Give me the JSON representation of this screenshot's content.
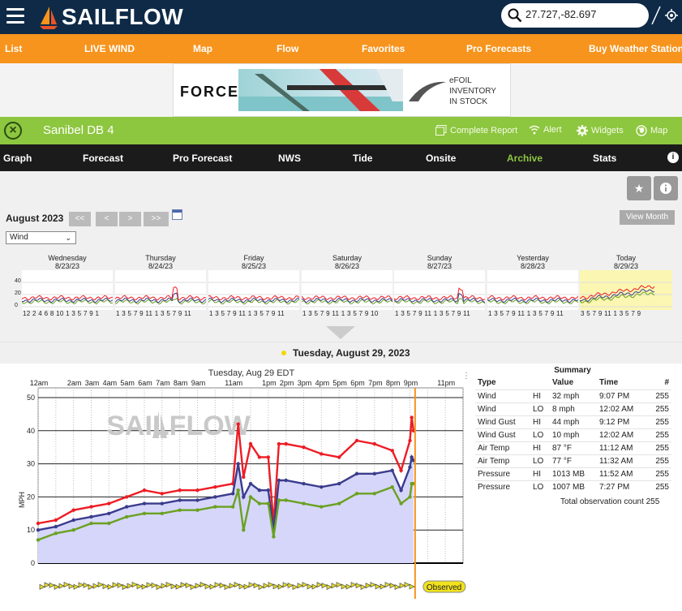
{
  "header": {
    "logo": "SAILFLOW",
    "search_value": "27.727,-82.697"
  },
  "nav": [
    "List",
    "LIVE WIND",
    "Map",
    "Flow",
    "Favorites",
    "Pro Forecasts",
    "Buy Weather Station"
  ],
  "ad": {
    "brand": "FORCE",
    "tag_line1": "eFOIL",
    "tag_line2": "INVENTORY",
    "tag_line3": "IN STOCK"
  },
  "station": {
    "name": "Sanibel DB 4",
    "actions": [
      "Complete Report",
      "Alert",
      "Widgets",
      "Map"
    ]
  },
  "tabs": [
    "Graph",
    "Forecast",
    "Pro Forecast",
    "NWS",
    "Tide",
    "Onsite",
    "Archive",
    "Stats"
  ],
  "active_tab": "Archive",
  "archive": {
    "month": "August 2023",
    "nav_buttons": [
      "<<",
      "<",
      ">",
      ">>"
    ],
    "view_month": "View Month",
    "selected_param": "Wind",
    "days": [
      {
        "name": "Wednesday",
        "date": "8/23/23",
        "axis": "12 2 4 6 8 10 1 3 5 7 9 1"
      },
      {
        "name": "Thursday",
        "date": "8/24/23",
        "axis": "1 3 5 7 9 11 1 3 5 7 9 11"
      },
      {
        "name": "Friday",
        "date": "8/25/23",
        "axis": "1 3 5 7 9 11 1 3 5 7 9 11"
      },
      {
        "name": "Saturday",
        "date": "8/26/23",
        "axis": "1 3 5 7 9 11 1 3 5 7 9 10"
      },
      {
        "name": "Sunday",
        "date": "8/27/23",
        "axis": "1 3 5 7 9 11 1 3 5 7 9 11"
      },
      {
        "name": "Yesterday",
        "date": "8/28/23",
        "axis": "1 3 5 7 9 11 1 3 5 7 9 11"
      },
      {
        "name": "Today",
        "date": "8/29/23",
        "axis": "3 5 7 9 11 1 3 5 7 9"
      }
    ],
    "thumb_yticks": [
      "40",
      "20",
      "0"
    ],
    "selected_date": "Tuesday, August 29, 2023"
  },
  "colors": {
    "brand_navy": "#0f2a47",
    "orange": "#f7941d",
    "station_green": "#8dc63f",
    "active_tab": "#8dc63f",
    "wind": "#3a3c8c",
    "gust": "#ee1c24",
    "lull": "#6aa121",
    "today_highlight": "#fbf6b2",
    "now_line": "#f7941d"
  },
  "chart_data": {
    "type": "line",
    "title": "Tuesday, Aug 29 EDT",
    "xlabel": "",
    "ylabel": "MPH",
    "x_tick_labels": [
      "12am",
      "2am",
      "3am",
      "4am",
      "5am",
      "6am",
      "7am",
      "8am",
      "9am",
      "11am",
      "1pm",
      "2pm",
      "3pm",
      "4pm",
      "5pm",
      "6pm",
      "7pm",
      "8pm",
      "9pm",
      "11pm"
    ],
    "ylim": [
      0,
      50
    ],
    "y_ticks": [
      0,
      10,
      20,
      30,
      40,
      50
    ],
    "grid": true,
    "watermark": "SAILFLOW",
    "now_label": "Observed",
    "x_hours": [
      0,
      1,
      2,
      3,
      4,
      5,
      6,
      7,
      8,
      9,
      10,
      11,
      11.3,
      11.6,
      12,
      12.5,
      13,
      13.3,
      13.6,
      14,
      15,
      16,
      17,
      18,
      19,
      20,
      20.5,
      21,
      21.1,
      21.2
    ],
    "series": [
      {
        "values": [
          12,
          13,
          16,
          17,
          18,
          20,
          22,
          21,
          22,
          22,
          23,
          24,
          42,
          26,
          36,
          32,
          32,
          12,
          36,
          36,
          35,
          33,
          32,
          37,
          36,
          34,
          28,
          37,
          44,
          40
        ]
      },
      {
        "values": [
          10,
          11,
          13,
          14,
          15,
          17,
          18,
          18,
          19,
          19,
          20,
          21,
          30,
          20,
          24,
          22,
          22,
          10,
          25,
          25,
          24,
          23,
          24,
          27,
          27,
          28,
          22,
          29,
          32,
          31
        ]
      },
      {
        "values": [
          7,
          9,
          10,
          12,
          12,
          14,
          15,
          15,
          16,
          16,
          17,
          17,
          22,
          10,
          20,
          18,
          18,
          8,
          19,
          19,
          18,
          17,
          18,
          21,
          21,
          23,
          18,
          20,
          24,
          24
        ]
      }
    ]
  },
  "summary": {
    "title": "Summary",
    "headers": [
      "Type",
      "",
      "Value",
      "Time",
      "#"
    ],
    "rows": [
      [
        "Wind",
        "HI",
        "32 mph",
        "9:07 PM",
        "255"
      ],
      [
        "Wind",
        "LO",
        "8 mph",
        "12:02 AM",
        "255"
      ],
      [
        "Wind Gust",
        "HI",
        "44 mph",
        "9:12 PM",
        "255"
      ],
      [
        "Wind Gust",
        "LO",
        "10 mph",
        "12:02 AM",
        "255"
      ],
      [
        "Air Temp",
        "HI",
        "87 °F",
        "11:12 AM",
        "255"
      ],
      [
        "Air Temp",
        "LO",
        "77 °F",
        "11:32 AM",
        "255"
      ],
      [
        "Pressure",
        "HI",
        "1013 MB",
        "11:52 AM",
        "255"
      ],
      [
        "Pressure",
        "LO",
        "1007 MB",
        "7:27 PM",
        "255"
      ]
    ],
    "total_label": "Total observation count",
    "total_value": "255"
  }
}
